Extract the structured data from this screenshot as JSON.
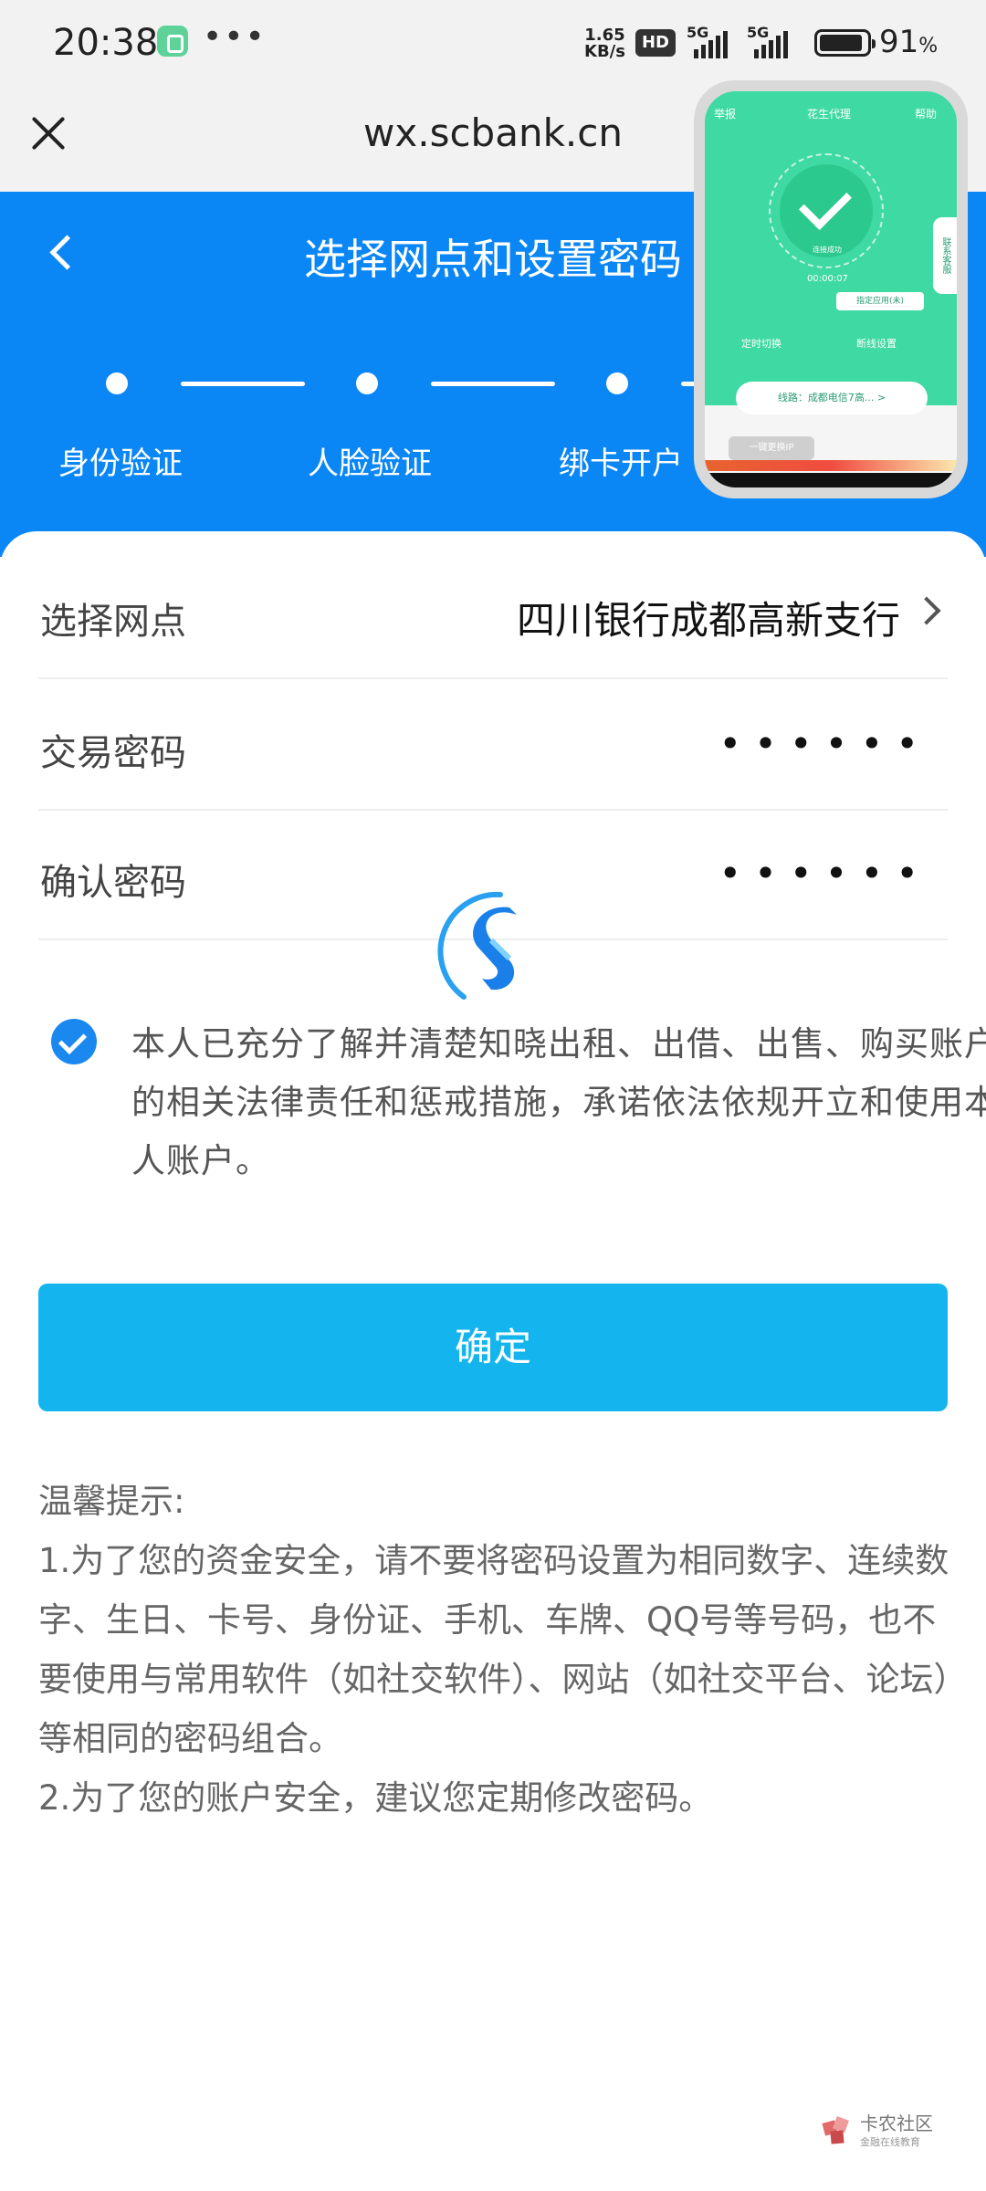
{
  "status_bar": {
    "time": "20:38",
    "more": "•••",
    "net_speed_value": "1.65",
    "net_speed_unit": "KB/s",
    "hd": "HD",
    "sim1": "5G",
    "sim2": "5G",
    "battery_percent": "91",
    "battery_unit": "%",
    "battery_level": 0.91
  },
  "browser": {
    "url": "wx.scbank.cn"
  },
  "header": {
    "title": "选择网点和设置密码",
    "steps": [
      "身份验证",
      "人脸验证",
      "绑卡开户"
    ],
    "colors": {
      "brand_blue": "#0b86f5",
      "button": "#14b5ee"
    }
  },
  "form": {
    "branch_label": "选择网点",
    "branch_value": "四川银行成都高新支行",
    "trade_password_label": "交易密码",
    "trade_password_value": "••••••",
    "confirm_password_label": "确认密码",
    "confirm_password_value": "••••••"
  },
  "agreement": {
    "checked": true,
    "text": "本人已充分了解并清楚知晓出租、出借、出售、购买账户的相关法律责任和惩戒措施，承诺依法依规开立和使用本人账户。"
  },
  "confirm_button": "确定",
  "tips": {
    "title": "温馨提示:",
    "item1": "1.为了您的资金安全，请不要将密码设置为相同数字、连续数字、生日、卡号、身份证、手机、车牌、QQ号等号码，也不要使用与常用软件（如社交软件）、网站（如社交平台、论坛）等相同的密码组合。",
    "item2": "2.为了您的账户安全，建议您定期修改密码。"
  },
  "floating_window": {
    "left_label": "举报",
    "center_label": "花生代理",
    "right_label": "帮助",
    "status": "连接成功",
    "timer": "00:00:07",
    "mode": "定时切换",
    "setting": "断线设置",
    "line": "线路：成都电信7高... >",
    "one_click": "一键更换IP",
    "side_tab": "联系客服",
    "chip": "指定应用(未)"
  },
  "watermark": {
    "name": "卡农社区",
    "sub": "金融在线教育"
  }
}
